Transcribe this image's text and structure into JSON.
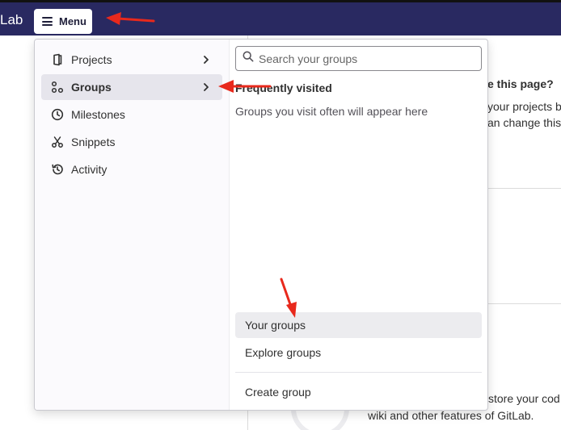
{
  "topbar": {
    "logo_text": "Lab",
    "menu_label": "Menu"
  },
  "background": {
    "heading_fragment": "e this page?",
    "line1_fragment": "your projects b",
    "line2_fragment": "an change this",
    "footer_line1_fragment": "store your cod",
    "footer_line2_fragment": "wiki and other features of GitLab."
  },
  "dropdown": {
    "left_items": [
      {
        "label": "Projects",
        "icon": "project-icon",
        "has_chevron": true
      },
      {
        "label": "Groups",
        "icon": "group-icon",
        "has_chevron": true,
        "active": true
      },
      {
        "label": "Milestones",
        "icon": "clock-icon",
        "has_chevron": false
      },
      {
        "label": "Snippets",
        "icon": "scissors-icon",
        "has_chevron": false
      },
      {
        "label": "Activity",
        "icon": "history-icon",
        "has_chevron": false
      }
    ],
    "search_placeholder": "Search your groups",
    "frequently_visited_title": "Frequently visited",
    "frequently_visited_empty": "Groups you visit often will appear here",
    "right_links": [
      {
        "label": "Your groups",
        "active": true
      },
      {
        "label": "Explore groups"
      },
      {
        "label": "Create group"
      }
    ]
  },
  "colors": {
    "topbar": "#292961",
    "annotation_arrow": "#e8291c",
    "active_item_bg": "#e6e5ec"
  }
}
